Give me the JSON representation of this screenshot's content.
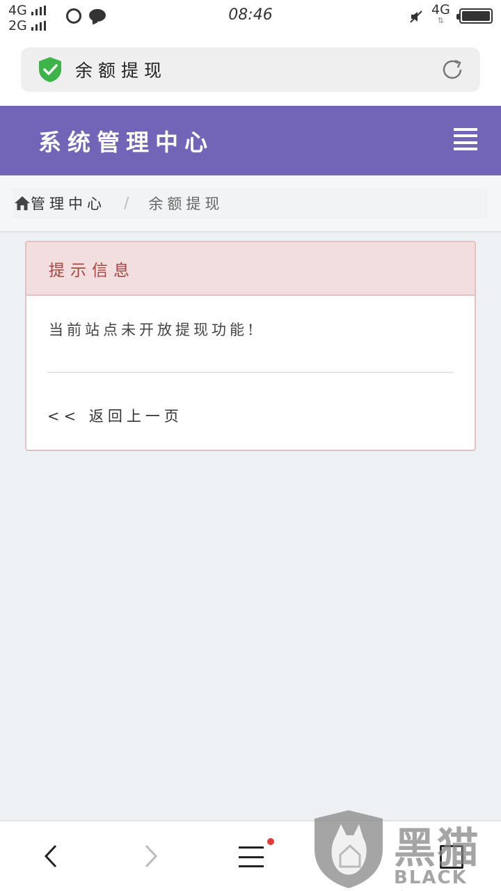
{
  "status_bar": {
    "network_1": "4G",
    "network_2": "2G",
    "time": "08:46",
    "data_type": "4G",
    "data_arrows": "⇅",
    "icons": [
      "signal-bars-icon",
      "globe-icon",
      "chat-icon",
      "mute-icon",
      "battery-icon"
    ]
  },
  "address_bar": {
    "title": "余额提现",
    "icons": [
      "secure-shield-icon",
      "reload-icon"
    ]
  },
  "header": {
    "title": "系统管理中心",
    "color": "#7265b8"
  },
  "breadcrumb": {
    "home": "管理中心",
    "separator": "/",
    "current": "余额提现"
  },
  "panel": {
    "title": "提示信息",
    "message": "当前站点未开放提现功能!",
    "back_link": "<< 返回上一页",
    "heading_color": "#a84442"
  },
  "bottom_nav": {
    "items": [
      "back-icon",
      "forward-icon",
      "menu-icon",
      "home-icon",
      "tabs-icon"
    ],
    "tab_count": "1"
  },
  "watermark": {
    "name_cn": "黑猫",
    "name_en": "BLACK CAT"
  }
}
